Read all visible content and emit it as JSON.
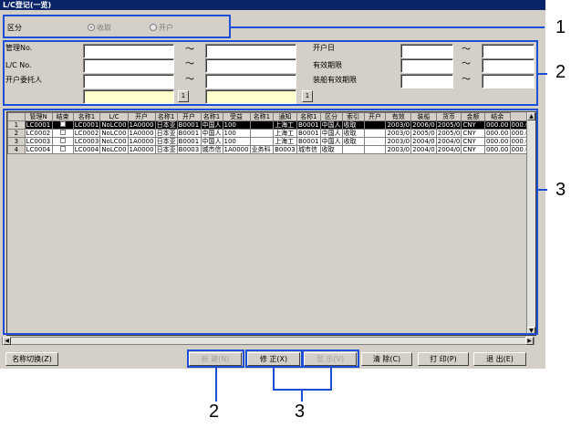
{
  "window": {
    "title": "L/C登记(一览)"
  },
  "section1": {
    "label": "区分",
    "radio_options": [
      {
        "label": "收取",
        "selected": true
      },
      {
        "label": "开户",
        "selected": false
      }
    ]
  },
  "search": {
    "left_labels": [
      "管理No.",
      "L/C No.",
      "开户委托人"
    ],
    "right_labels": [
      "开户日",
      "有效期限",
      "装船有效期限"
    ],
    "tilde": "～",
    "lookup_button_label": "1"
  },
  "grid": {
    "columns": [
      "管理N",
      "结束",
      "名称1",
      "L/C",
      "开户",
      "名称1",
      "开户",
      "名称1",
      "受益",
      "名称1",
      "通知",
      "名称1",
      "区分",
      "索引",
      "开户",
      "有效",
      "装船",
      "货币",
      "金额",
      "结余"
    ],
    "rows": [
      {
        "num": "1",
        "cells": [
          "LC0001",
          "",
          "LC0001",
          "NoLC00",
          "1A0000",
          "日本亚",
          "B0001",
          "中国人",
          "100",
          "",
          "上海工",
          "B0001",
          "中国人",
          "收取",
          "",
          "2003/0",
          "2006/0",
          "2005/0",
          "CNY",
          "000.00",
          "000.00"
        ]
      },
      {
        "num": "2",
        "cells": [
          "LC0002",
          "",
          "LC0002",
          "NoLC00",
          "1A0000",
          "日本亚",
          "B0001",
          "中国人",
          "100",
          "",
          "上海工",
          "B0001",
          "中国人",
          "收取",
          "",
          "2003/0",
          "2005/0",
          "2005/0",
          "CNY",
          "000.00",
          "000.00"
        ]
      },
      {
        "num": "3",
        "cells": [
          "LC0003",
          "",
          "LC0003",
          "NoLC00",
          "1A0000",
          "日本亚",
          "B0001",
          "中国人",
          "100",
          "",
          "上海工",
          "B0001",
          "中国人",
          "收取",
          "",
          "2003/0",
          "2004/0",
          "2004/0",
          "CNY",
          "000.00",
          "000.00"
        ]
      },
      {
        "num": "4",
        "cells": [
          "LC0004",
          "",
          "LC0004",
          "NoLC00",
          "1A0000",
          "日本亚",
          "B0003",
          "城市信",
          "1A0000",
          "业务科",
          "B0003",
          "城市信",
          "收取",
          "",
          "",
          "2003/0",
          "2004/0",
          "2004/0",
          "CNY",
          "000.00",
          "000.00"
        ]
      }
    ]
  },
  "buttons": {
    "name_switch": "名称切换(Z)",
    "new": "新 建(N)",
    "edit": "修 正(X)",
    "display": "显 示(V)",
    "clear": "清 除(C)",
    "print": "打 印(P)",
    "exit": "退 出(E)"
  },
  "callouts": [
    "1",
    "2",
    "3",
    "2",
    "3"
  ]
}
